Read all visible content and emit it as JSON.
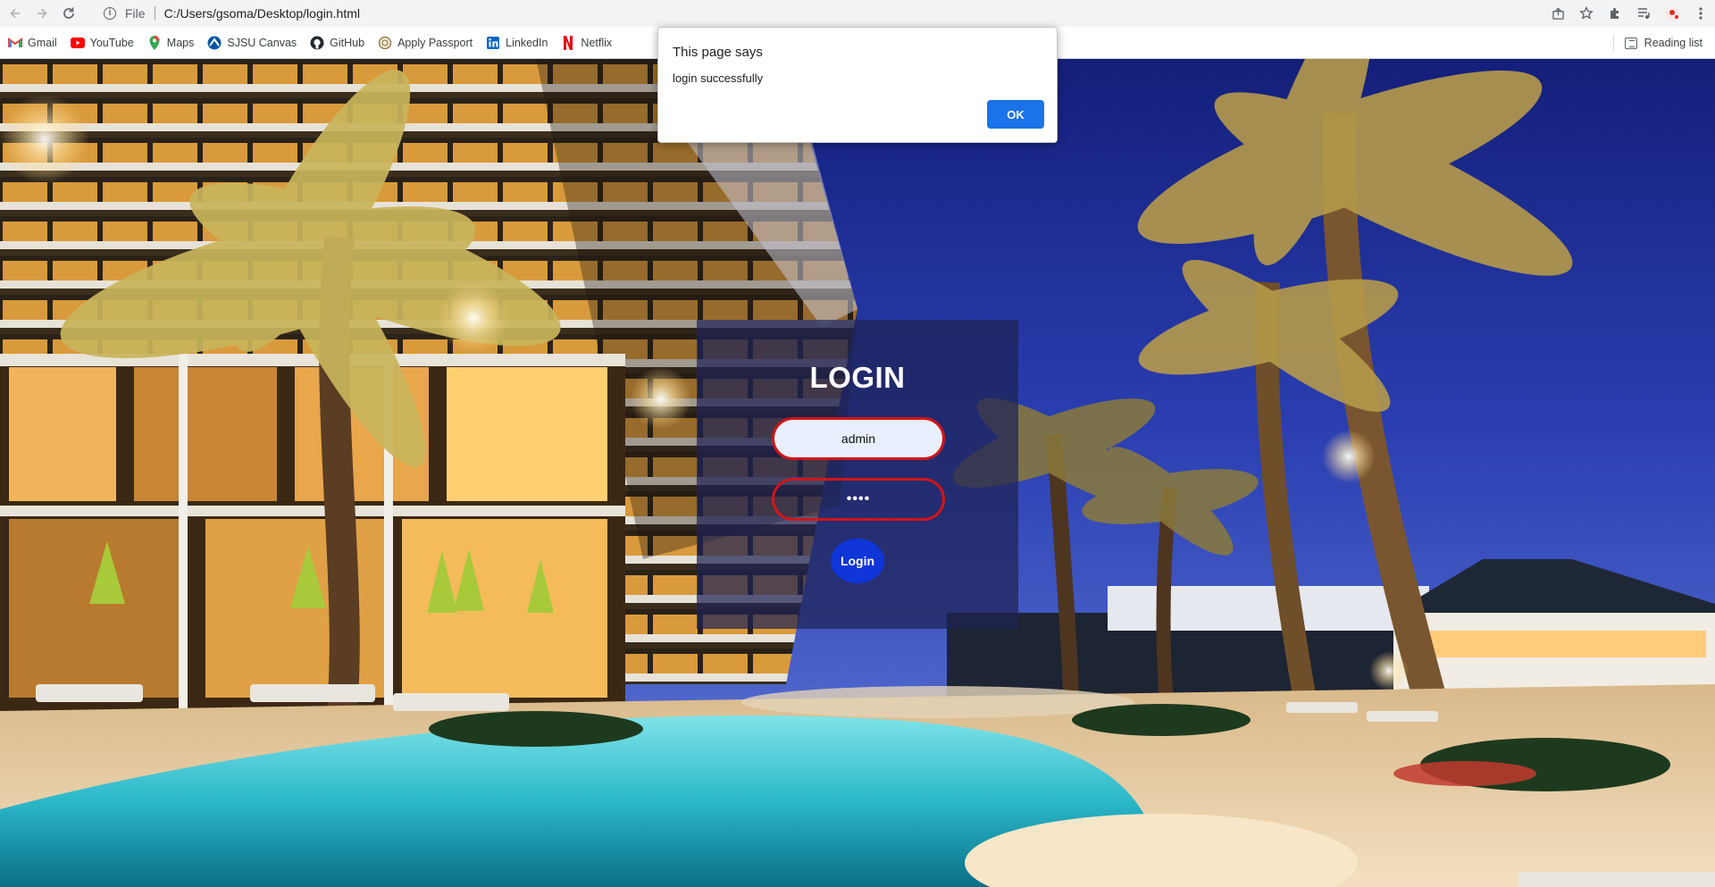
{
  "browser": {
    "scheme": "File",
    "url": "C:/Users/gsoma/Desktop/login.html"
  },
  "bookmarks": [
    {
      "label": "Gmail",
      "icon": "gmail-icon",
      "color": "#ea4335"
    },
    {
      "label": "YouTube",
      "icon": "youtube-icon",
      "color": "#ff0000"
    },
    {
      "label": "Maps",
      "icon": "maps-icon",
      "color": "#34a853"
    },
    {
      "label": "SJSU Canvas",
      "icon": "canvas-icon",
      "color": "#0055a2"
    },
    {
      "label": "GitHub",
      "icon": "github-icon",
      "color": "#24292e"
    },
    {
      "label": "Apply Passport",
      "icon": "passport-icon",
      "color": "#8a6d3b"
    },
    {
      "label": "LinkedIn",
      "icon": "linkedin-icon",
      "color": "#0a66c2"
    },
    {
      "label": "Netflix",
      "icon": "netflix-icon",
      "color": "#e50914"
    }
  ],
  "reading_list": "Reading list",
  "login": {
    "title": "LOGIN",
    "username_value": "admin",
    "password_value": "••••",
    "button_label": "Login"
  },
  "alert": {
    "title": "This page says",
    "message": "login successfully",
    "ok_label": "OK"
  },
  "colors": {
    "accent": "#1a73e8",
    "login_button": "#1035d8",
    "input_border": "#d11518"
  }
}
